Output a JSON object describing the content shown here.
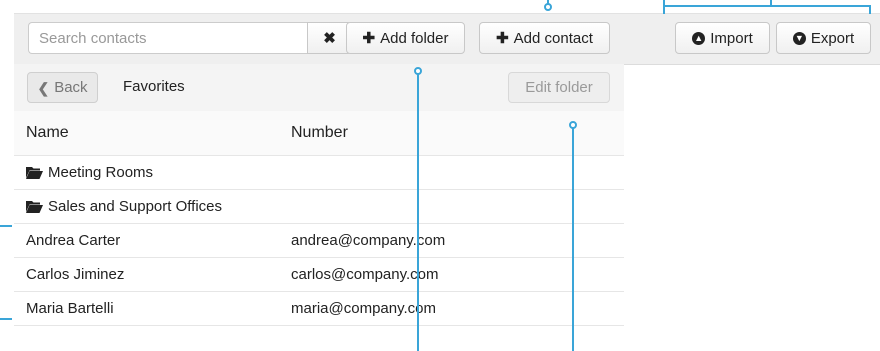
{
  "toolbar": {
    "search_placeholder": "Search contacts",
    "search_value": "",
    "clear_label": "✖",
    "add_folder_label": "Add folder",
    "add_contact_label": "Add contact",
    "import_label": "Import",
    "export_label": "Export"
  },
  "folder_bar": {
    "back_label": "Back",
    "title": "Favorites",
    "edit_label": "Edit folder"
  },
  "table": {
    "columns": [
      "Name",
      "Number"
    ],
    "rows": [
      {
        "type": "folder",
        "name": "Meeting Rooms",
        "number": ""
      },
      {
        "type": "folder",
        "name": "Sales and Support Offices",
        "number": ""
      },
      {
        "type": "contact",
        "name": "Andrea Carter",
        "number": "andrea@company.com"
      },
      {
        "type": "contact",
        "name": "Carlos Jiminez",
        "number": "carlos@company.com"
      },
      {
        "type": "contact",
        "name": "Maria Bartelli",
        "number": "maria@company.com"
      }
    ]
  },
  "icons": {
    "clear": "close-icon",
    "add": "plus-icon",
    "import": "circle-up-arrow-icon",
    "export": "circle-down-arrow-icon",
    "back": "chevron-left-icon",
    "folder": "folder-open-icon"
  },
  "colors": {
    "callout": "#3aa5d8",
    "toolbar_bg": "#efefef"
  }
}
